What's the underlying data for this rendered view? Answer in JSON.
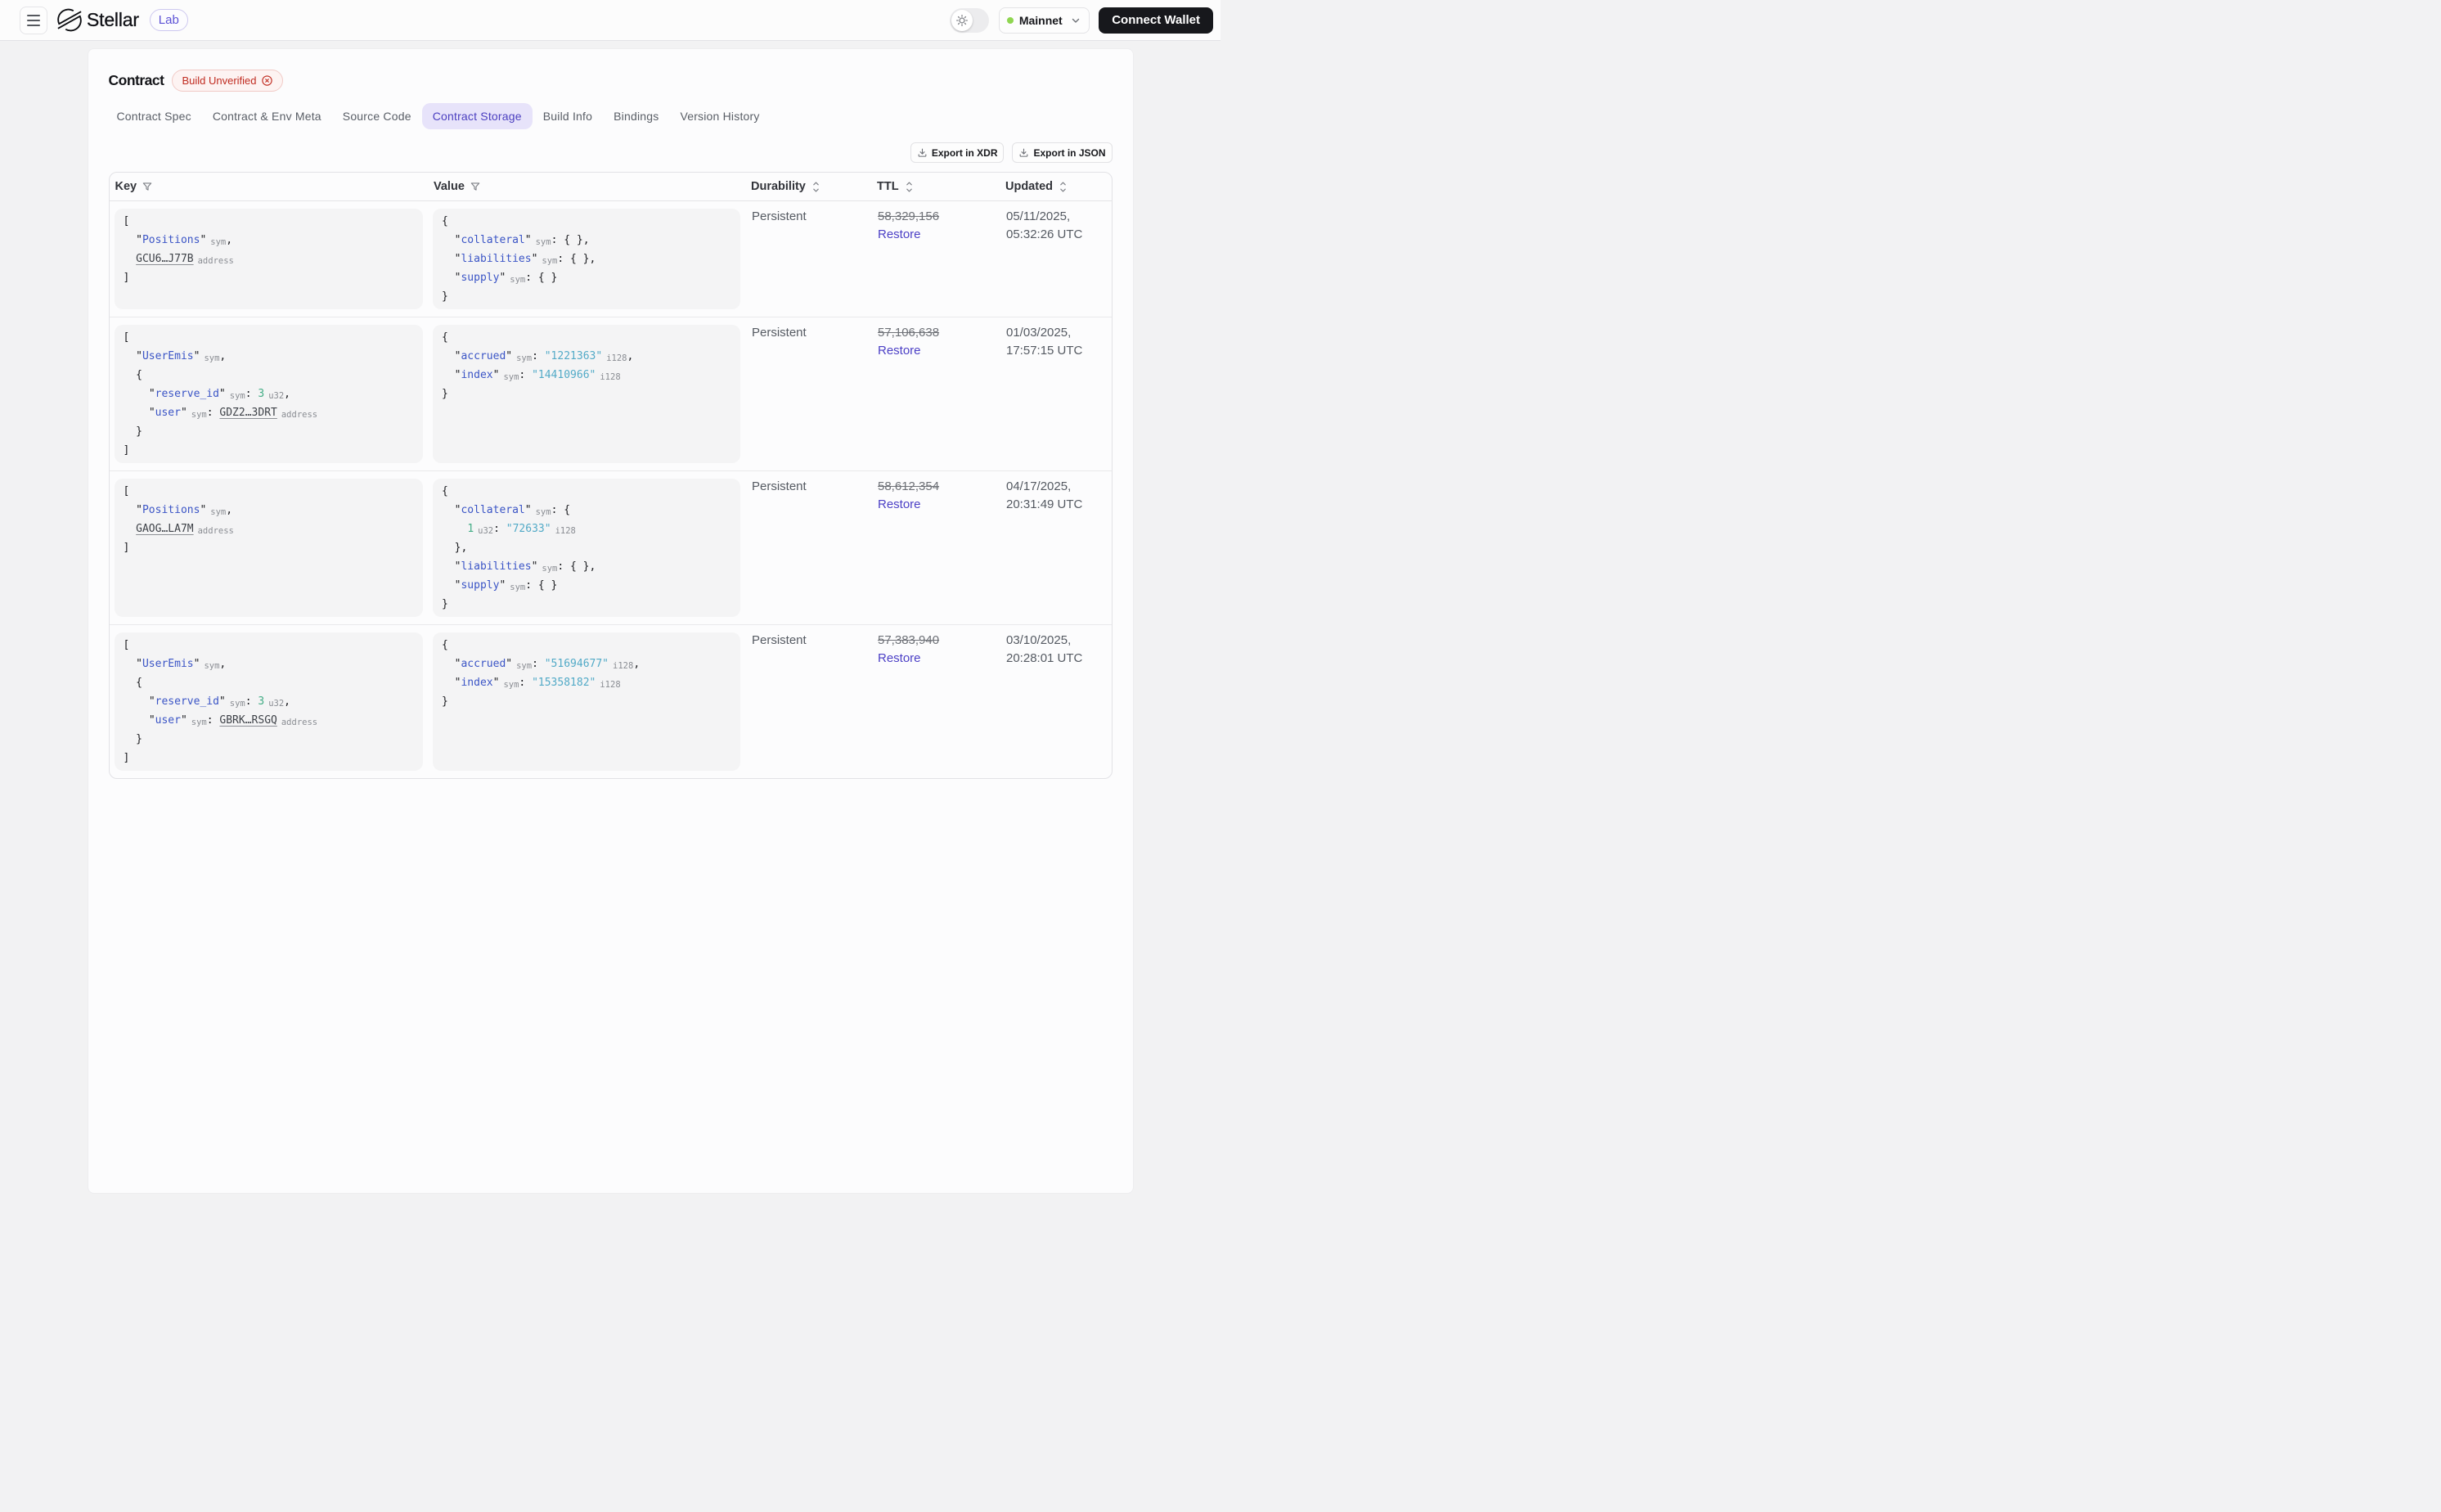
{
  "header": {
    "brand": "Stellar",
    "product_badge": "Lab",
    "network": {
      "label": "Mainnet"
    },
    "connect_label": "Connect Wallet"
  },
  "page": {
    "title": "Contract",
    "status_badge": "Build Unverified",
    "tabs": [
      {
        "label": "Contract Spec",
        "active": false
      },
      {
        "label": "Contract & Env Meta",
        "active": false
      },
      {
        "label": "Source Code",
        "active": false
      },
      {
        "label": "Contract Storage",
        "active": true
      },
      {
        "label": "Build Info",
        "active": false
      },
      {
        "label": "Bindings",
        "active": false
      },
      {
        "label": "Version History",
        "active": false
      }
    ],
    "export_buttons": [
      "Export in XDR",
      "Export in JSON"
    ]
  },
  "table": {
    "columns": [
      {
        "label": "Key",
        "icon": "filter"
      },
      {
        "label": "Value",
        "icon": "filter"
      },
      {
        "label": "Durability",
        "icon": "sort"
      },
      {
        "label": "TTL",
        "icon": "sort"
      },
      {
        "label": "Updated",
        "icon": "sort"
      }
    ],
    "rows": [
      {
        "key_code": [
          [
            [
              "p",
              "["
            ]
          ],
          [
            [
              "p",
              "  "
            ],
            [
              "q",
              "\""
            ],
            [
              "k",
              "Positions"
            ],
            [
              "q",
              "\""
            ],
            [
              "a",
              "sym"
            ],
            [
              "p",
              ","
            ]
          ],
          [
            [
              "p",
              "  "
            ],
            [
              "d",
              "GCU6…J77B"
            ],
            [
              "a",
              "address"
            ]
          ],
          [
            [
              "p",
              "]"
            ]
          ]
        ],
        "value_code": [
          [
            [
              "p",
              "{"
            ]
          ],
          [
            [
              "p",
              "  "
            ],
            [
              "q",
              "\""
            ],
            [
              "k",
              "collateral"
            ],
            [
              "q",
              "\""
            ],
            [
              "a",
              "sym"
            ],
            [
              "p",
              ": { },"
            ]
          ],
          [
            [
              "p",
              "  "
            ],
            [
              "q",
              "\""
            ],
            [
              "k",
              "liabilities"
            ],
            [
              "q",
              "\""
            ],
            [
              "a",
              "sym"
            ],
            [
              "p",
              ": { },"
            ]
          ],
          [
            [
              "p",
              "  "
            ],
            [
              "q",
              "\""
            ],
            [
              "k",
              "supply"
            ],
            [
              "q",
              "\""
            ],
            [
              "a",
              "sym"
            ],
            [
              "p",
              ": { }"
            ]
          ],
          [
            [
              "p",
              "}"
            ]
          ]
        ],
        "durability": "Persistent",
        "ttl": "58,329,156",
        "ttl_action": "Restore",
        "updated_date": "05/11/2025,",
        "updated_time": "05:32:26 UTC"
      },
      {
        "key_code": [
          [
            [
              "p",
              "["
            ]
          ],
          [
            [
              "p",
              "  "
            ],
            [
              "q",
              "\""
            ],
            [
              "k",
              "UserEmis"
            ],
            [
              "q",
              "\""
            ],
            [
              "a",
              "sym"
            ],
            [
              "p",
              ","
            ]
          ],
          [
            [
              "p",
              "  {"
            ]
          ],
          [
            [
              "p",
              "    "
            ],
            [
              "q",
              "\""
            ],
            [
              "k",
              "reserve_id"
            ],
            [
              "q",
              "\""
            ],
            [
              "a",
              "sym"
            ],
            [
              "p",
              ": "
            ],
            [
              "g",
              "3"
            ],
            [
              "a",
              "u32"
            ],
            [
              "p",
              ","
            ]
          ],
          [
            [
              "p",
              "    "
            ],
            [
              "q",
              "\""
            ],
            [
              "k",
              "user"
            ],
            [
              "q",
              "\""
            ],
            [
              "a",
              "sym"
            ],
            [
              "p",
              ": "
            ],
            [
              "d",
              "GDZ2…3DRT"
            ],
            [
              "a",
              "address"
            ]
          ],
          [
            [
              "p",
              "  }"
            ]
          ],
          [
            [
              "p",
              "]"
            ]
          ]
        ],
        "value_code": [
          [
            [
              "p",
              "{"
            ]
          ],
          [
            [
              "p",
              "  "
            ],
            [
              "q",
              "\""
            ],
            [
              "k",
              "accrued"
            ],
            [
              "q",
              "\""
            ],
            [
              "a",
              "sym"
            ],
            [
              "p",
              ": "
            ],
            [
              "n",
              "\"1221363\""
            ],
            [
              "a",
              "i128"
            ],
            [
              "p",
              ","
            ]
          ],
          [
            [
              "p",
              "  "
            ],
            [
              "q",
              "\""
            ],
            [
              "k",
              "index"
            ],
            [
              "q",
              "\""
            ],
            [
              "a",
              "sym"
            ],
            [
              "p",
              ": "
            ],
            [
              "n",
              "\"14410966\""
            ],
            [
              "a",
              "i128"
            ]
          ],
          [
            [
              "p",
              "}"
            ]
          ]
        ],
        "durability": "Persistent",
        "ttl": "57,106,638",
        "ttl_action": "Restore",
        "updated_date": "01/03/2025,",
        "updated_time": "17:57:15 UTC"
      },
      {
        "key_code": [
          [
            [
              "p",
              "["
            ]
          ],
          [
            [
              "p",
              "  "
            ],
            [
              "q",
              "\""
            ],
            [
              "k",
              "Positions"
            ],
            [
              "q",
              "\""
            ],
            [
              "a",
              "sym"
            ],
            [
              "p",
              ","
            ]
          ],
          [
            [
              "p",
              "  "
            ],
            [
              "d",
              "GAOG…LA7M"
            ],
            [
              "a",
              "address"
            ]
          ],
          [
            [
              "p",
              "]"
            ]
          ]
        ],
        "value_code": [
          [
            [
              "p",
              "{"
            ]
          ],
          [
            [
              "p",
              "  "
            ],
            [
              "q",
              "\""
            ],
            [
              "k",
              "collateral"
            ],
            [
              "q",
              "\""
            ],
            [
              "a",
              "sym"
            ],
            [
              "p",
              ": {"
            ]
          ],
          [
            [
              "p",
              "    "
            ],
            [
              "g",
              "1"
            ],
            [
              "a",
              "u32"
            ],
            [
              "p",
              ": "
            ],
            [
              "n",
              "\"72633\""
            ],
            [
              "a",
              "i128"
            ]
          ],
          [
            [
              "p",
              "  },"
            ]
          ],
          [
            [
              "p",
              "  "
            ],
            [
              "q",
              "\""
            ],
            [
              "k",
              "liabilities"
            ],
            [
              "q",
              "\""
            ],
            [
              "a",
              "sym"
            ],
            [
              "p",
              ": { },"
            ]
          ],
          [
            [
              "p",
              "  "
            ],
            [
              "q",
              "\""
            ],
            [
              "k",
              "supply"
            ],
            [
              "q",
              "\""
            ],
            [
              "a",
              "sym"
            ],
            [
              "p",
              ": { }"
            ]
          ],
          [
            [
              "p",
              "}"
            ]
          ]
        ],
        "durability": "Persistent",
        "ttl": "58,612,354",
        "ttl_action": "Restore",
        "updated_date": "04/17/2025,",
        "updated_time": "20:31:49 UTC"
      },
      {
        "key_code": [
          [
            [
              "p",
              "["
            ]
          ],
          [
            [
              "p",
              "  "
            ],
            [
              "q",
              "\""
            ],
            [
              "k",
              "UserEmis"
            ],
            [
              "q",
              "\""
            ],
            [
              "a",
              "sym"
            ],
            [
              "p",
              ","
            ]
          ],
          [
            [
              "p",
              "  {"
            ]
          ],
          [
            [
              "p",
              "    "
            ],
            [
              "q",
              "\""
            ],
            [
              "k",
              "reserve_id"
            ],
            [
              "q",
              "\""
            ],
            [
              "a",
              "sym"
            ],
            [
              "p",
              ": "
            ],
            [
              "g",
              "3"
            ],
            [
              "a",
              "u32"
            ],
            [
              "p",
              ","
            ]
          ],
          [
            [
              "p",
              "    "
            ],
            [
              "q",
              "\""
            ],
            [
              "k",
              "user"
            ],
            [
              "q",
              "\""
            ],
            [
              "a",
              "sym"
            ],
            [
              "p",
              ": "
            ],
            [
              "d",
              "GBRK…RSGQ"
            ],
            [
              "a",
              "address"
            ]
          ],
          [
            [
              "p",
              "  }"
            ]
          ],
          [
            [
              "p",
              "]"
            ]
          ]
        ],
        "value_code": [
          [
            [
              "p",
              "{"
            ]
          ],
          [
            [
              "p",
              "  "
            ],
            [
              "q",
              "\""
            ],
            [
              "k",
              "accrued"
            ],
            [
              "q",
              "\""
            ],
            [
              "a",
              "sym"
            ],
            [
              "p",
              ": "
            ],
            [
              "n",
              "\"51694677\""
            ],
            [
              "a",
              "i128"
            ],
            [
              "p",
              ","
            ]
          ],
          [
            [
              "p",
              "  "
            ],
            [
              "q",
              "\""
            ],
            [
              "k",
              "index"
            ],
            [
              "q",
              "\""
            ],
            [
              "a",
              "sym"
            ],
            [
              "p",
              ": "
            ],
            [
              "n",
              "\"15358182\""
            ],
            [
              "a",
              "i128"
            ]
          ],
          [
            [
              "p",
              "}"
            ]
          ]
        ],
        "durability": "Persistent",
        "ttl": "57,383,940",
        "ttl_action": "Restore",
        "updated_date": "03/10/2025,",
        "updated_time": "20:28:01 UTC"
      }
    ]
  }
}
